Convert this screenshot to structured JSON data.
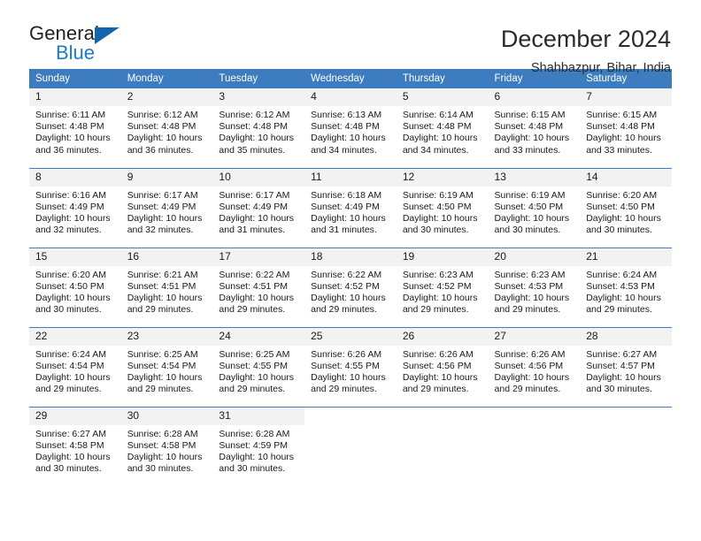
{
  "brand": {
    "name_primary": "General",
    "name_secondary": "Blue",
    "accent_color": "#1f7ac4",
    "triangle_color": "#1464ad"
  },
  "header": {
    "title": "December 2024",
    "subtitle": "Shahbazpur, Bihar, India"
  },
  "calendar": {
    "header_bg": "#3c7cbf",
    "daynum_bg": "#f2f2f2",
    "weekday_headers": [
      "Sunday",
      "Monday",
      "Tuesday",
      "Wednesday",
      "Thursday",
      "Friday",
      "Saturday"
    ],
    "weeks": [
      [
        {
          "day": "1",
          "sunrise": "Sunrise: 6:11 AM",
          "sunset": "Sunset: 4:48 PM",
          "daylight_line1": "Daylight: 10 hours",
          "daylight_line2": "and 36 minutes."
        },
        {
          "day": "2",
          "sunrise": "Sunrise: 6:12 AM",
          "sunset": "Sunset: 4:48 PM",
          "daylight_line1": "Daylight: 10 hours",
          "daylight_line2": "and 36 minutes."
        },
        {
          "day": "3",
          "sunrise": "Sunrise: 6:12 AM",
          "sunset": "Sunset: 4:48 PM",
          "daylight_line1": "Daylight: 10 hours",
          "daylight_line2": "and 35 minutes."
        },
        {
          "day": "4",
          "sunrise": "Sunrise: 6:13 AM",
          "sunset": "Sunset: 4:48 PM",
          "daylight_line1": "Daylight: 10 hours",
          "daylight_line2": "and 34 minutes."
        },
        {
          "day": "5",
          "sunrise": "Sunrise: 6:14 AM",
          "sunset": "Sunset: 4:48 PM",
          "daylight_line1": "Daylight: 10 hours",
          "daylight_line2": "and 34 minutes."
        },
        {
          "day": "6",
          "sunrise": "Sunrise: 6:15 AM",
          "sunset": "Sunset: 4:48 PM",
          "daylight_line1": "Daylight: 10 hours",
          "daylight_line2": "and 33 minutes."
        },
        {
          "day": "7",
          "sunrise": "Sunrise: 6:15 AM",
          "sunset": "Sunset: 4:48 PM",
          "daylight_line1": "Daylight: 10 hours",
          "daylight_line2": "and 33 minutes."
        }
      ],
      [
        {
          "day": "8",
          "sunrise": "Sunrise: 6:16 AM",
          "sunset": "Sunset: 4:49 PM",
          "daylight_line1": "Daylight: 10 hours",
          "daylight_line2": "and 32 minutes."
        },
        {
          "day": "9",
          "sunrise": "Sunrise: 6:17 AM",
          "sunset": "Sunset: 4:49 PM",
          "daylight_line1": "Daylight: 10 hours",
          "daylight_line2": "and 32 minutes."
        },
        {
          "day": "10",
          "sunrise": "Sunrise: 6:17 AM",
          "sunset": "Sunset: 4:49 PM",
          "daylight_line1": "Daylight: 10 hours",
          "daylight_line2": "and 31 minutes."
        },
        {
          "day": "11",
          "sunrise": "Sunrise: 6:18 AM",
          "sunset": "Sunset: 4:49 PM",
          "daylight_line1": "Daylight: 10 hours",
          "daylight_line2": "and 31 minutes."
        },
        {
          "day": "12",
          "sunrise": "Sunrise: 6:19 AM",
          "sunset": "Sunset: 4:50 PM",
          "daylight_line1": "Daylight: 10 hours",
          "daylight_line2": "and 30 minutes."
        },
        {
          "day": "13",
          "sunrise": "Sunrise: 6:19 AM",
          "sunset": "Sunset: 4:50 PM",
          "daylight_line1": "Daylight: 10 hours",
          "daylight_line2": "and 30 minutes."
        },
        {
          "day": "14",
          "sunrise": "Sunrise: 6:20 AM",
          "sunset": "Sunset: 4:50 PM",
          "daylight_line1": "Daylight: 10 hours",
          "daylight_line2": "and 30 minutes."
        }
      ],
      [
        {
          "day": "15",
          "sunrise": "Sunrise: 6:20 AM",
          "sunset": "Sunset: 4:50 PM",
          "daylight_line1": "Daylight: 10 hours",
          "daylight_line2": "and 30 minutes."
        },
        {
          "day": "16",
          "sunrise": "Sunrise: 6:21 AM",
          "sunset": "Sunset: 4:51 PM",
          "daylight_line1": "Daylight: 10 hours",
          "daylight_line2": "and 29 minutes."
        },
        {
          "day": "17",
          "sunrise": "Sunrise: 6:22 AM",
          "sunset": "Sunset: 4:51 PM",
          "daylight_line1": "Daylight: 10 hours",
          "daylight_line2": "and 29 minutes."
        },
        {
          "day": "18",
          "sunrise": "Sunrise: 6:22 AM",
          "sunset": "Sunset: 4:52 PM",
          "daylight_line1": "Daylight: 10 hours",
          "daylight_line2": "and 29 minutes."
        },
        {
          "day": "19",
          "sunrise": "Sunrise: 6:23 AM",
          "sunset": "Sunset: 4:52 PM",
          "daylight_line1": "Daylight: 10 hours",
          "daylight_line2": "and 29 minutes."
        },
        {
          "day": "20",
          "sunrise": "Sunrise: 6:23 AM",
          "sunset": "Sunset: 4:53 PM",
          "daylight_line1": "Daylight: 10 hours",
          "daylight_line2": "and 29 minutes."
        },
        {
          "day": "21",
          "sunrise": "Sunrise: 6:24 AM",
          "sunset": "Sunset: 4:53 PM",
          "daylight_line1": "Daylight: 10 hours",
          "daylight_line2": "and 29 minutes."
        }
      ],
      [
        {
          "day": "22",
          "sunrise": "Sunrise: 6:24 AM",
          "sunset": "Sunset: 4:54 PM",
          "daylight_line1": "Daylight: 10 hours",
          "daylight_line2": "and 29 minutes."
        },
        {
          "day": "23",
          "sunrise": "Sunrise: 6:25 AM",
          "sunset": "Sunset: 4:54 PM",
          "daylight_line1": "Daylight: 10 hours",
          "daylight_line2": "and 29 minutes."
        },
        {
          "day": "24",
          "sunrise": "Sunrise: 6:25 AM",
          "sunset": "Sunset: 4:55 PM",
          "daylight_line1": "Daylight: 10 hours",
          "daylight_line2": "and 29 minutes."
        },
        {
          "day": "25",
          "sunrise": "Sunrise: 6:26 AM",
          "sunset": "Sunset: 4:55 PM",
          "daylight_line1": "Daylight: 10 hours",
          "daylight_line2": "and 29 minutes."
        },
        {
          "day": "26",
          "sunrise": "Sunrise: 6:26 AM",
          "sunset": "Sunset: 4:56 PM",
          "daylight_line1": "Daylight: 10 hours",
          "daylight_line2": "and 29 minutes."
        },
        {
          "day": "27",
          "sunrise": "Sunrise: 6:26 AM",
          "sunset": "Sunset: 4:56 PM",
          "daylight_line1": "Daylight: 10 hours",
          "daylight_line2": "and 29 minutes."
        },
        {
          "day": "28",
          "sunrise": "Sunrise: 6:27 AM",
          "sunset": "Sunset: 4:57 PM",
          "daylight_line1": "Daylight: 10 hours",
          "daylight_line2": "and 30 minutes."
        }
      ],
      [
        {
          "day": "29",
          "sunrise": "Sunrise: 6:27 AM",
          "sunset": "Sunset: 4:58 PM",
          "daylight_line1": "Daylight: 10 hours",
          "daylight_line2": "and 30 minutes."
        },
        {
          "day": "30",
          "sunrise": "Sunrise: 6:28 AM",
          "sunset": "Sunset: 4:58 PM",
          "daylight_line1": "Daylight: 10 hours",
          "daylight_line2": "and 30 minutes."
        },
        {
          "day": "31",
          "sunrise": "Sunrise: 6:28 AM",
          "sunset": "Sunset: 4:59 PM",
          "daylight_line1": "Daylight: 10 hours",
          "daylight_line2": "and 30 minutes."
        },
        {
          "day": "",
          "sunrise": "",
          "sunset": "",
          "daylight_line1": "",
          "daylight_line2": ""
        },
        {
          "day": "",
          "sunrise": "",
          "sunset": "",
          "daylight_line1": "",
          "daylight_line2": ""
        },
        {
          "day": "",
          "sunrise": "",
          "sunset": "",
          "daylight_line1": "",
          "daylight_line2": ""
        },
        {
          "day": "",
          "sunrise": "",
          "sunset": "",
          "daylight_line1": "",
          "daylight_line2": ""
        }
      ]
    ]
  }
}
